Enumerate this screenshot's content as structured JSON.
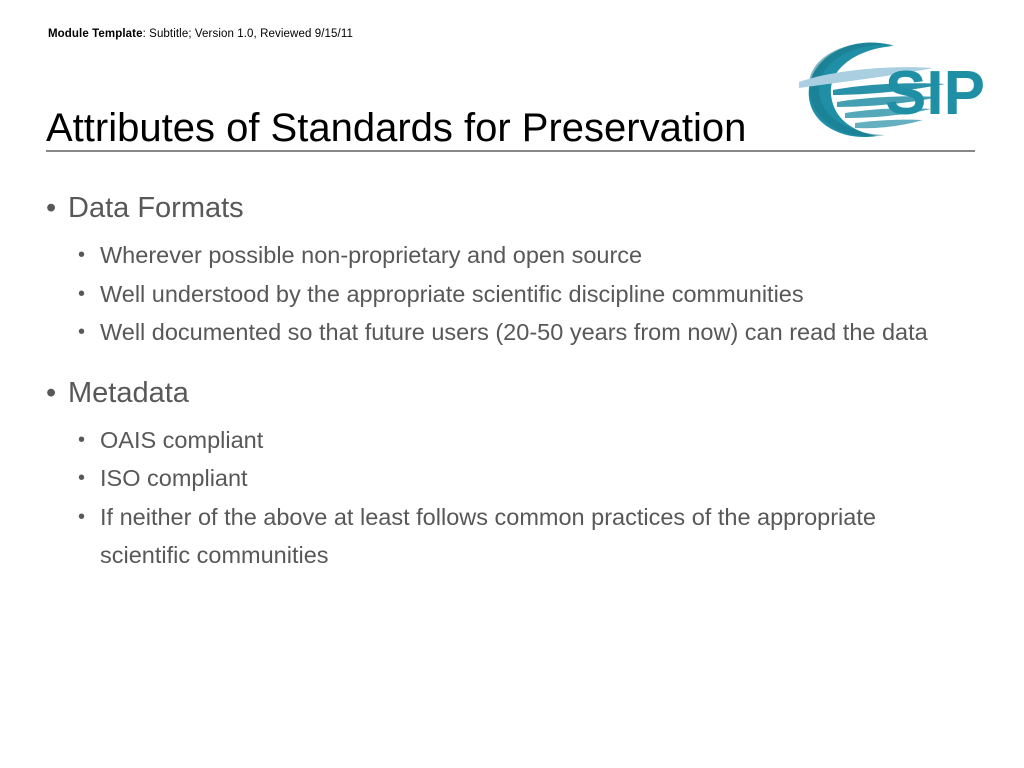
{
  "slide": {
    "header": {
      "bold_prefix": "Module Template",
      "rest": ": Subtitle; Version 1.0, Reviewed 9/15/11"
    },
    "logo": {
      "name": "esip-logo",
      "wordmark": "SIP",
      "colors": {
        "teal": "#1f8fa6",
        "teal_dark": "#17788c",
        "light_blue": "#a9cfe0",
        "pale_blue": "#cfe4ee"
      }
    },
    "title": "Attributes of Standards for Preservation",
    "rule_color": "#888888",
    "body_text_color": "#585858",
    "bullet_glyph": "•",
    "sections": [
      {
        "heading": "Data Formats",
        "items": [
          "Wherever possible non-proprietary and open source",
          "Well understood by the appropriate scientific discipline communities",
          "Well documented so that future users (20-50 years from now) can read the data"
        ]
      },
      {
        "heading": "Metadata",
        "items": [
          "OAIS compliant",
          "ISO compliant",
          "If neither of the above at least follows common practices of the appropriate scientific communities"
        ]
      }
    ]
  }
}
